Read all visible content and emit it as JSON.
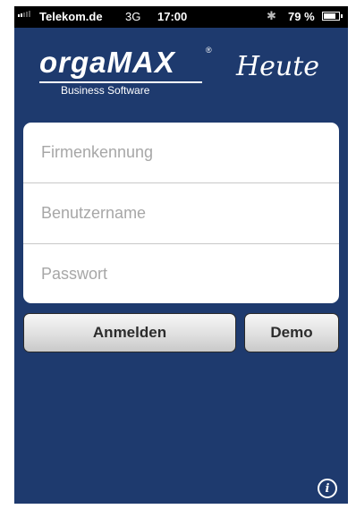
{
  "statusbar": {
    "carrier": "Telekom.de",
    "network": "3G",
    "time": "17:00",
    "battery_percent": "79 %",
    "battery_level": 0.79
  },
  "header": {
    "logo_text": "orgaMAX",
    "logo_subtitle": "Business Software",
    "registered_mark": "®",
    "heute": "Heute"
  },
  "form": {
    "company_placeholder": "Firmenkennung",
    "username_placeholder": "Benutzername",
    "password_placeholder": "Passwort"
  },
  "actions": {
    "login_label": "Anmelden",
    "demo_label": "Demo"
  },
  "footer": {
    "info_label": "i"
  },
  "colors": {
    "background": "#1e3a6e",
    "field_bg": "#ffffff",
    "button_text": "#2c2c2c"
  }
}
